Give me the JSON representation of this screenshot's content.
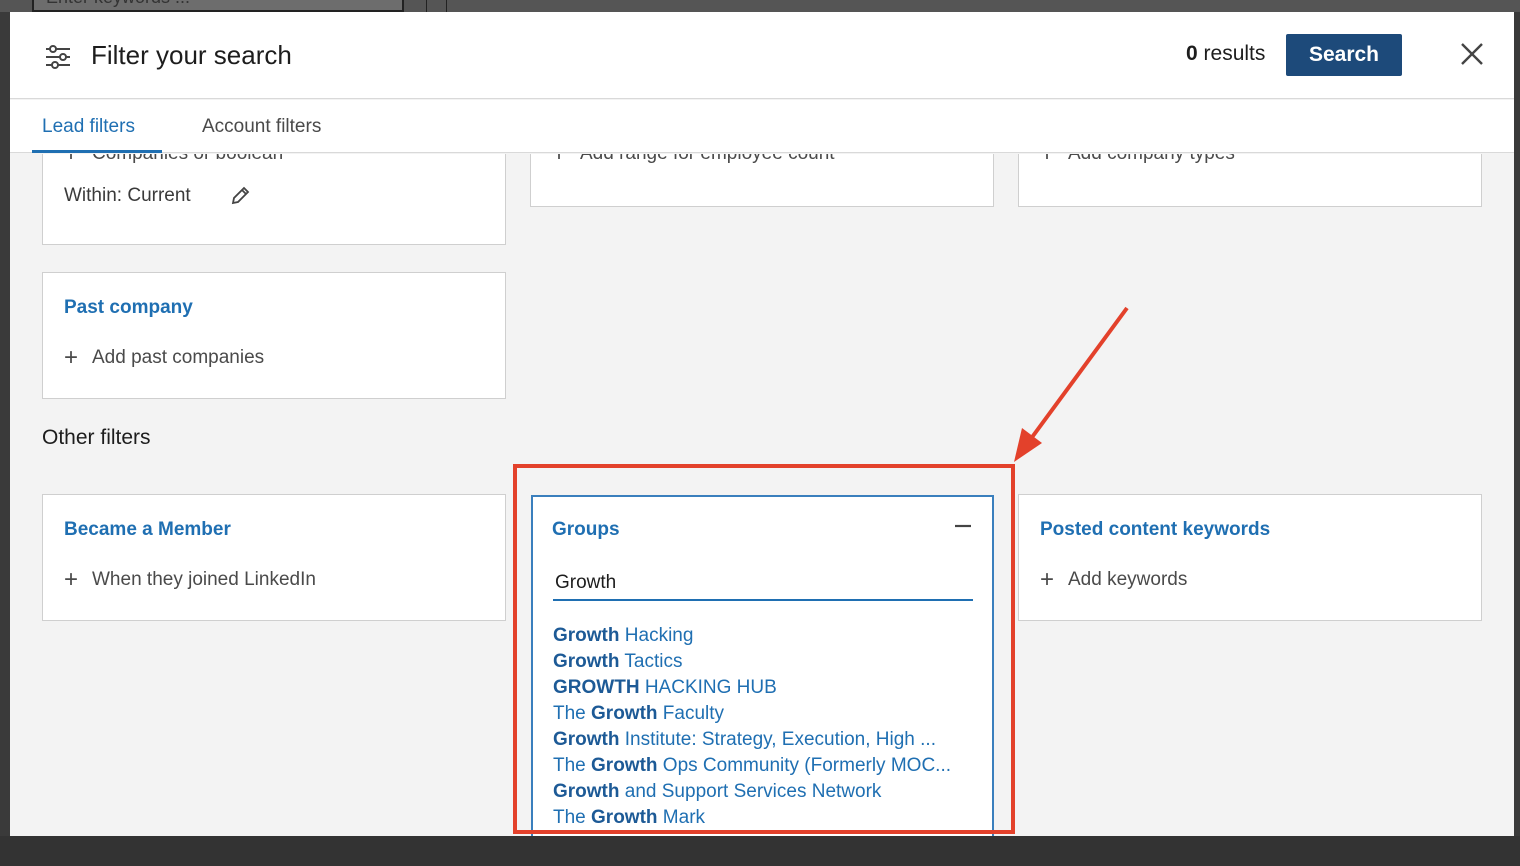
{
  "background": {
    "search_placeholder": "Enter keywords ..."
  },
  "header": {
    "title": "Filter your search",
    "results_count": "0",
    "results_label": "results",
    "search_label": "Search",
    "close_icon": "close-icon",
    "filter_icon": "sliders-icon"
  },
  "tabs": [
    {
      "label": "Lead filters",
      "active": true
    },
    {
      "label": "Account filters",
      "active": false
    }
  ],
  "top_cards": {
    "current_company": {
      "add_label": "Companies or boolean",
      "within_label": "Within: Current"
    },
    "headcount": {
      "add_label": "Add range for employee count"
    },
    "company_type": {
      "add_label": "Add company types"
    }
  },
  "past_company": {
    "title": "Past company",
    "add_label": "Add past companies"
  },
  "other_filters_heading": "Other filters",
  "became_member": {
    "title": "Became a Member",
    "add_label": "When they joined LinkedIn"
  },
  "groups": {
    "title": "Groups",
    "input_value": "Growth",
    "suggestions": [
      {
        "pre": "",
        "match": "Growth",
        "post": " Hacking"
      },
      {
        "pre": "",
        "match": "Growth",
        "post": " Tactics"
      },
      {
        "pre": "",
        "match": "GROWTH",
        "post": " HACKING HUB"
      },
      {
        "pre": "The ",
        "match": "Growth",
        "post": " Faculty"
      },
      {
        "pre": "",
        "match": "Growth",
        "post": " Institute: Strategy, Execution, High ..."
      },
      {
        "pre": "The ",
        "match": "Growth",
        "post": " Ops Community (Formerly MOC..."
      },
      {
        "pre": "",
        "match": "Growth",
        "post": " and Support Services Network"
      },
      {
        "pre": "The ",
        "match": "Growth",
        "post": " Mark"
      }
    ]
  },
  "posted_content": {
    "title": "Posted content keywords",
    "add_label": "Add keywords"
  },
  "colors": {
    "accent": "#1f6fb2",
    "primary_button": "#1d4a7a",
    "annotation": "#e3412b"
  }
}
